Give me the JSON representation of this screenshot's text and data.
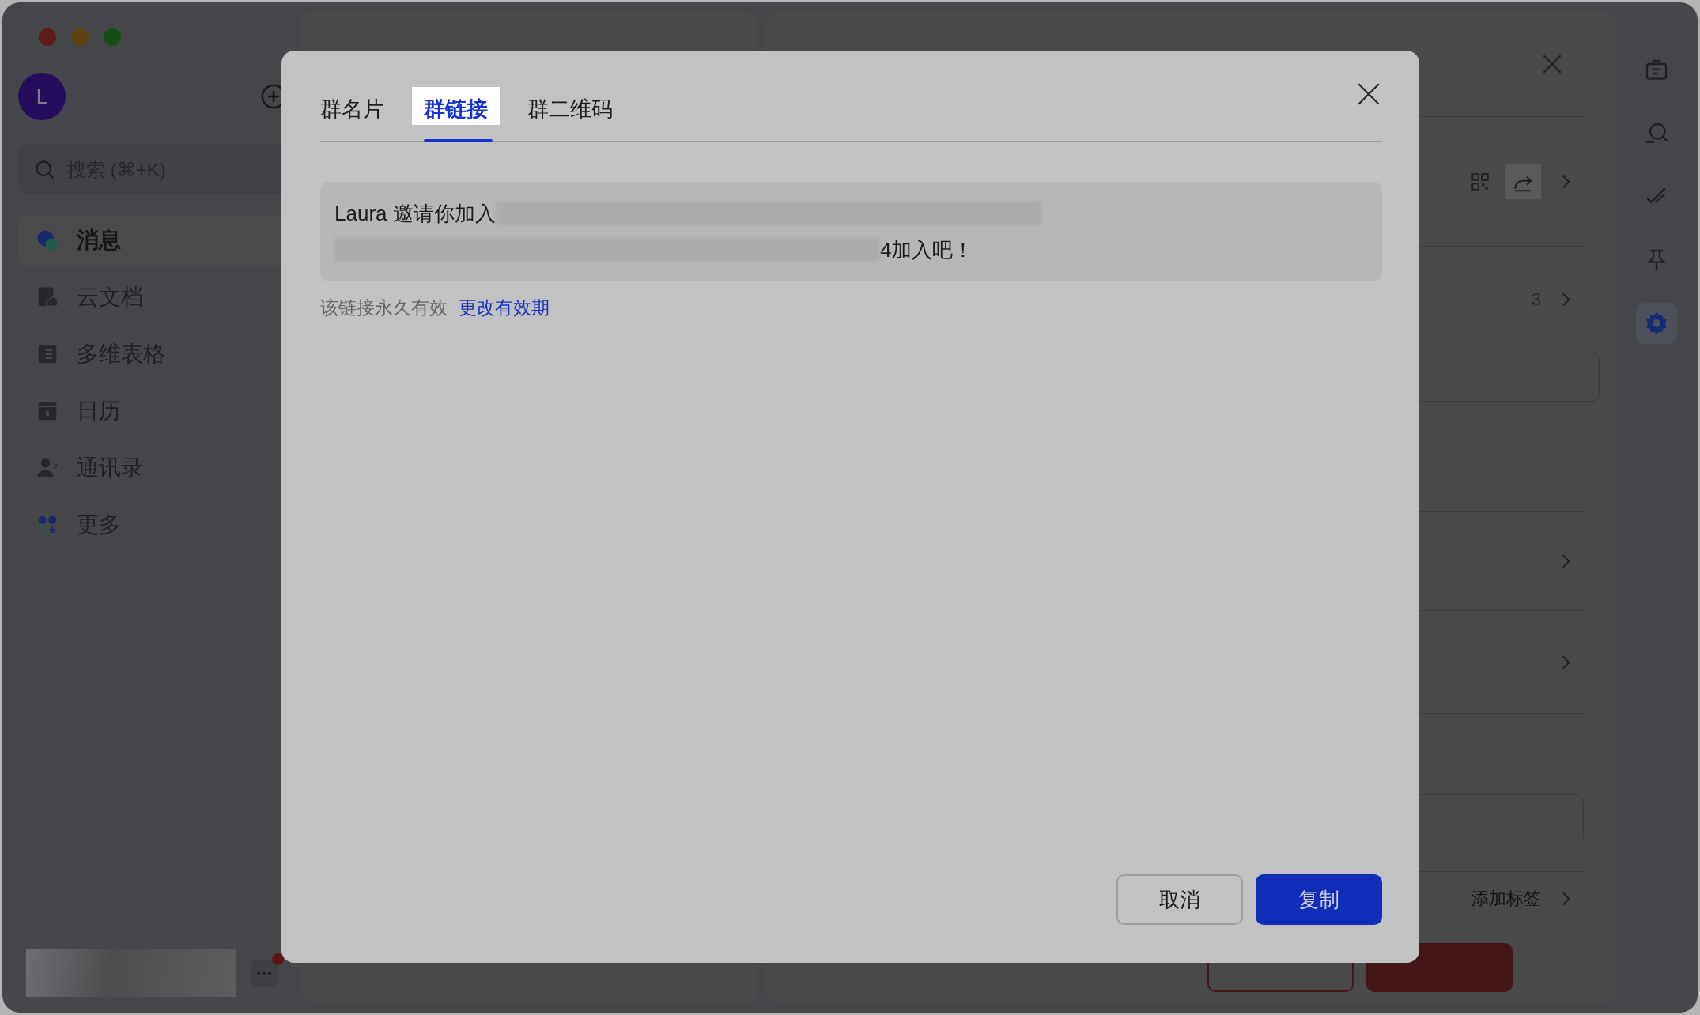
{
  "sidebar": {
    "avatar_initial": "L",
    "search": {
      "placeholder": "搜索 (⌘+K)"
    },
    "items": [
      {
        "label": "消息",
        "kind": "messages",
        "selected": true
      },
      {
        "label": "云文档",
        "kind": "docs",
        "selected": false
      },
      {
        "label": "多维表格",
        "kind": "table",
        "selected": false
      },
      {
        "label": "日历",
        "kind": "calendar",
        "selected": false
      },
      {
        "label": "通讯录",
        "kind": "contacts",
        "selected": false
      },
      {
        "label": "更多",
        "kind": "more",
        "selected": false
      }
    ]
  },
  "right_panel": {
    "member_count": "3",
    "tag_link": "添加标签"
  },
  "dialog": {
    "tabs": [
      {
        "label": "群名片",
        "selected": false
      },
      {
        "label": "群链接",
        "selected": true
      },
      {
        "label": "群二维码",
        "selected": false
      }
    ],
    "invite": {
      "prefix": "Laura 邀请你加入",
      "suffix": "4加入吧！"
    },
    "validity": "该链接永久有效",
    "change_link": "更改有效期",
    "buttons": [
      {
        "label": "取消",
        "kind": "secondary"
      },
      {
        "label": "复制",
        "kind": "primary"
      }
    ]
  }
}
